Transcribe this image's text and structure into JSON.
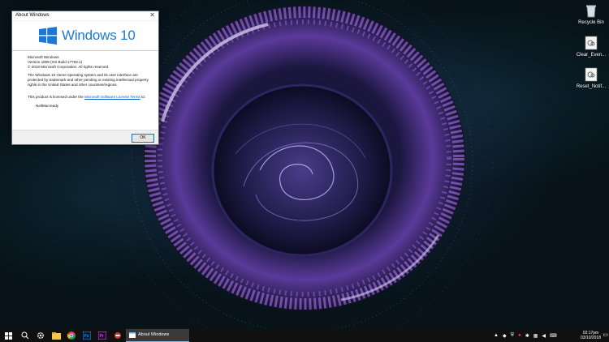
{
  "dialog": {
    "title": "About Windows",
    "close_glyph": "✕",
    "logo_text": "Windows 10",
    "product": "Microsoft Windows",
    "version": "Version 1809 (OS Build 17763.1)",
    "copyright": "© 2018 Microsoft Corporation. All rights reserved.",
    "legal": "The Windows 10 Home operating system and its user interface are protected by trademark and other pending or existing intellectual property rights in the United States and other countries/regions.",
    "license_prefix": "This product is licensed under the ",
    "license_link": "Microsoft Software License Terms",
    "license_suffix": " to:",
    "licensed_user": "NeilMacready",
    "ok_label": "OK"
  },
  "desktop_icons": [
    {
      "label": "Recycle Bin",
      "icon": "recycle-bin-icon"
    },
    {
      "label": "Clear_Even...",
      "icon": "script-file-icon"
    },
    {
      "label": "Reset_Notif...",
      "icon": "script-file-icon"
    }
  ],
  "taskbar": {
    "active_window_label": "About Windows",
    "pinned": [
      "start-icon",
      "search-icon",
      "settings-icon",
      "file-explorer-icon",
      "chrome-icon",
      "photoshop-icon",
      "premiere-icon",
      "app-icon"
    ],
    "clock_time": "02:17pm",
    "clock_date": "03/10/2018"
  },
  "colors": {
    "windows_blue": "#1b79d6",
    "link": "#0a5ec8",
    "taskbar": "#101010",
    "accent": "#76b9ed"
  }
}
